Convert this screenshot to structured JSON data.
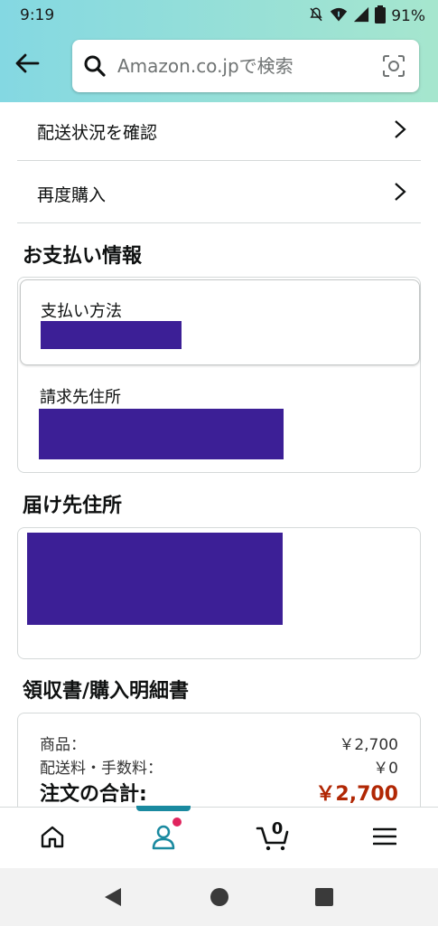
{
  "status_bar": {
    "time": "9:19",
    "battery": "91%"
  },
  "search": {
    "placeholder": "Amazon.co.jpで検索"
  },
  "actions": [
    {
      "label": "配送状況を確認"
    },
    {
      "label": "再度購入"
    }
  ],
  "payment_info": {
    "title": "お支払い情報",
    "payment_method_label": "支払い方法",
    "billing_address_label": "請求先住所"
  },
  "shipping": {
    "title": "届け先住所"
  },
  "receipt": {
    "title": "領収書/購入明細書",
    "rows": [
      {
        "label": "商品：",
        "value": "￥2,700"
      },
      {
        "label": "配送料・手数料：",
        "value": "￥0"
      }
    ],
    "total_label": "注文の合計:",
    "total_value": "￥2,700"
  },
  "bottom_nav": {
    "cart_count": "0",
    "active_tab": "account"
  },
  "colors": {
    "header_gradient_start": "#84d8e2",
    "header_gradient_end": "#a6e6ce",
    "redaction": "#3c1f96",
    "price_total": "#b12704",
    "nav_active": "#1a8aa0",
    "notification_dot": "#e0245e"
  },
  "icons": [
    "mute-icon",
    "wifi-icon",
    "signal-icon",
    "battery-icon",
    "back-arrow-icon",
    "search-icon",
    "camera-icon",
    "chevron-right-icon",
    "home-icon",
    "account-icon",
    "cart-icon",
    "menu-icon",
    "android-back-icon",
    "android-home-icon",
    "android-recents-icon"
  ]
}
